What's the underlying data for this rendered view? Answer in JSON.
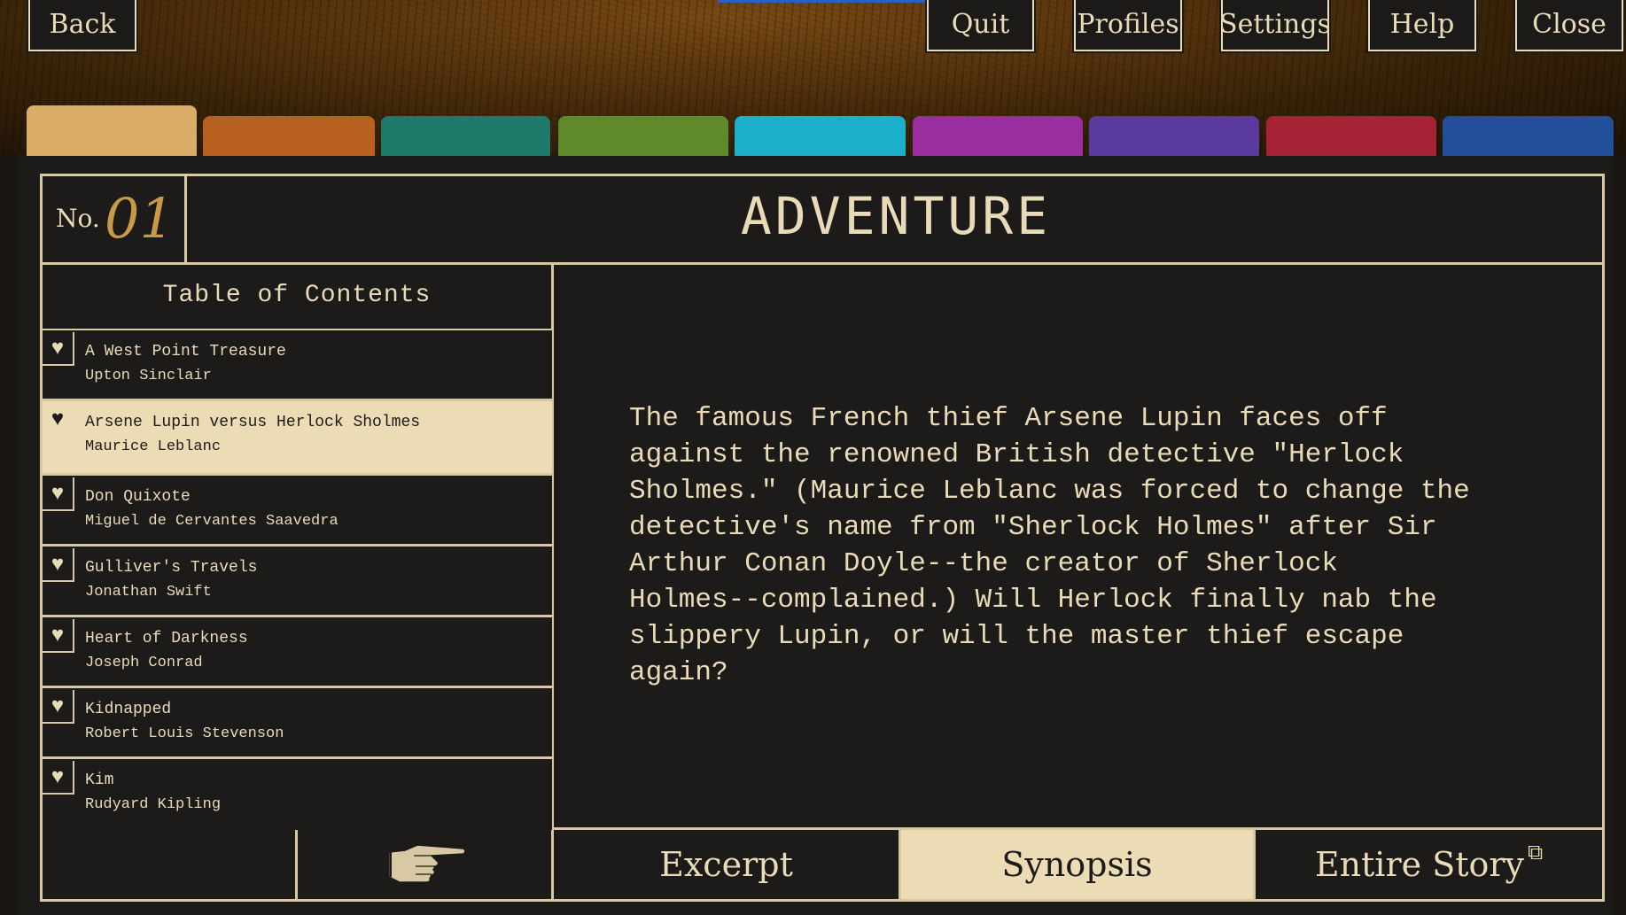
{
  "top_buttons": {
    "back": "Back",
    "quit": "Quit",
    "profiles": "Profiles",
    "settings": "Settings",
    "help": "Help",
    "close": "Close"
  },
  "tab_colors": [
    "#d9ac68",
    "#b8601e",
    "#1f7a6c",
    "#5e8a2c",
    "#1ab0cc",
    "#9a2e9e",
    "#5a3a9e",
    "#a82236",
    "#234e9a"
  ],
  "category": {
    "no_label": "No.",
    "number": "01",
    "title": "ADVENTURE"
  },
  "toc": {
    "title": "Table of Contents",
    "items": [
      {
        "title": "A West Point Treasure",
        "author": "Upton Sinclair"
      },
      {
        "title": "Arsene Lupin versus Herlock Sholmes",
        "author": "Maurice Leblanc"
      },
      {
        "title": "Don Quixote",
        "author": "Miguel de Cervantes Saavedra"
      },
      {
        "title": "Gulliver's Travels",
        "author": "Jonathan Swift"
      },
      {
        "title": "Heart of Darkness",
        "author": "Joseph Conrad"
      },
      {
        "title": "Kidnapped",
        "author": "Robert Louis Stevenson"
      },
      {
        "title": "Kim",
        "author": "Rudyard Kipling"
      }
    ],
    "selected_index": 1
  },
  "synopsis": "The famous French thief Arsene Lupin faces off\nagainst the renowned British detective \"Herlock\nSholmes.\" (Maurice Leblanc was forced to change the\ndetective's name from \"Sherlock Holmes\" after Sir\nArthur Conan Doyle--the creator of Sherlock\nHolmes--complained.) Will Herlock finally nab the\nslippery Lupin, or will the master thief escape\nagain?",
  "bottom_tabs": {
    "excerpt": "Excerpt",
    "synopsis": "Synopsis",
    "entire_story": "Entire Story",
    "active": "synopsis"
  },
  "icons": {
    "heart": "heart-icon",
    "pointer": "pointing-hand-icon",
    "external": "external-link-icon"
  }
}
